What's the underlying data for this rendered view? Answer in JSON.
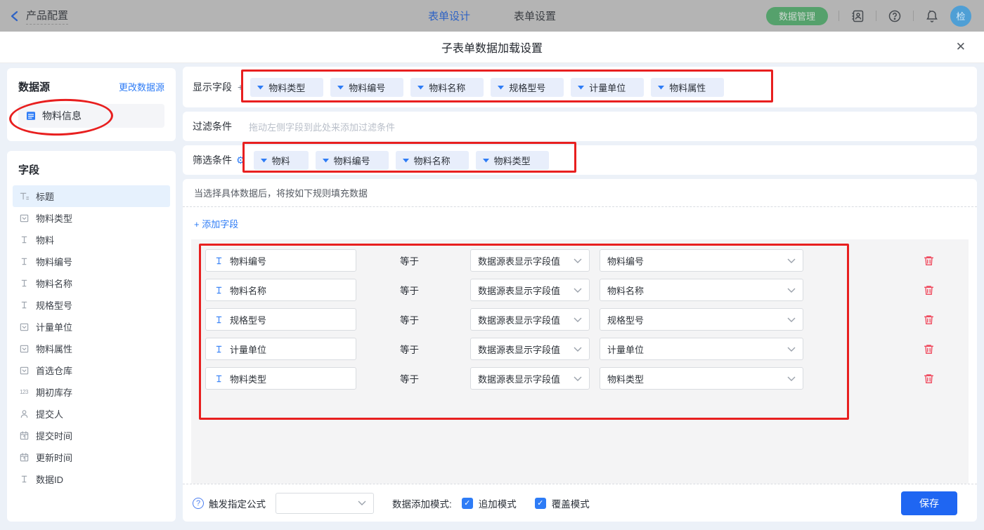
{
  "topbar": {
    "back_label": "产品配置",
    "tabs": [
      {
        "label": "表单设计",
        "active": true
      },
      {
        "label": "表单设置",
        "active": false
      }
    ],
    "data_manage_label": "数据管理",
    "avatar_text": "检"
  },
  "modal": {
    "title": "子表单数据加载设置",
    "close_glyph": "✕"
  },
  "sidebar": {
    "datasource": {
      "title": "数据源",
      "change_link": "更改数据源",
      "item": "物料信息"
    },
    "fields": {
      "title": "字段",
      "items": [
        {
          "label": "标题",
          "icon": "title",
          "selected": true
        },
        {
          "label": "物料类型",
          "icon": "select"
        },
        {
          "label": "物料",
          "icon": "text"
        },
        {
          "label": "物料编号",
          "icon": "text"
        },
        {
          "label": "物料名称",
          "icon": "text"
        },
        {
          "label": "规格型号",
          "icon": "text"
        },
        {
          "label": "计量单位",
          "icon": "select"
        },
        {
          "label": "物料属性",
          "icon": "select"
        },
        {
          "label": "首选仓库",
          "icon": "select"
        },
        {
          "label": "期初库存",
          "icon": "number"
        },
        {
          "label": "提交人",
          "icon": "user"
        },
        {
          "label": "提交时间",
          "icon": "date"
        },
        {
          "label": "更新时间",
          "icon": "date"
        },
        {
          "label": "数据ID",
          "icon": "text"
        }
      ]
    }
  },
  "main": {
    "display_fields": {
      "label": "显示字段",
      "add_glyph": "+",
      "tags": [
        "物料类型",
        "物料编号",
        "物料名称",
        "规格型号",
        "计量单位",
        "物料属性"
      ]
    },
    "filter": {
      "label": "过滤条件",
      "placeholder": "拖动左侧字段到此处来添加过滤条件"
    },
    "screen": {
      "label": "筛选条件",
      "gear_glyph": "⚙",
      "tags": [
        "物料",
        "物料编号",
        "物料名称",
        "物料类型"
      ]
    },
    "hint": "当选择具体数据后，将按如下规则填充数据",
    "add_field_label": "+ 添加字段",
    "rules": [
      {
        "field": "物料编号",
        "op": "等于",
        "source": "数据源表显示字段值",
        "value": "物料编号"
      },
      {
        "field": "物料名称",
        "op": "等于",
        "source": "数据源表显示字段值",
        "value": "物料名称"
      },
      {
        "field": "规格型号",
        "op": "等于",
        "source": "数据源表显示字段值",
        "value": "规格型号"
      },
      {
        "field": "计量单位",
        "op": "等于",
        "source": "数据源表显示字段值",
        "value": "计量单位"
      },
      {
        "field": "物料类型",
        "op": "等于",
        "source": "数据源表显示字段值",
        "value": "物料类型"
      }
    ],
    "footer": {
      "help_glyph": "?",
      "formula_label": "触发指定公式",
      "formula_value": "",
      "mode_label": "数据添加模式:",
      "modes": [
        {
          "label": "追加模式",
          "checked": true
        },
        {
          "label": "覆盖模式",
          "checked": true
        }
      ],
      "save_label": "保存"
    }
  },
  "colors": {
    "accent": "#2e7cf6",
    "save_button": "#1f66f2",
    "annotation_red": "#e81f1f",
    "green_button": "#55a16c",
    "trash_red": "#ef4a5e",
    "modal_background": "#ecf1f8"
  }
}
